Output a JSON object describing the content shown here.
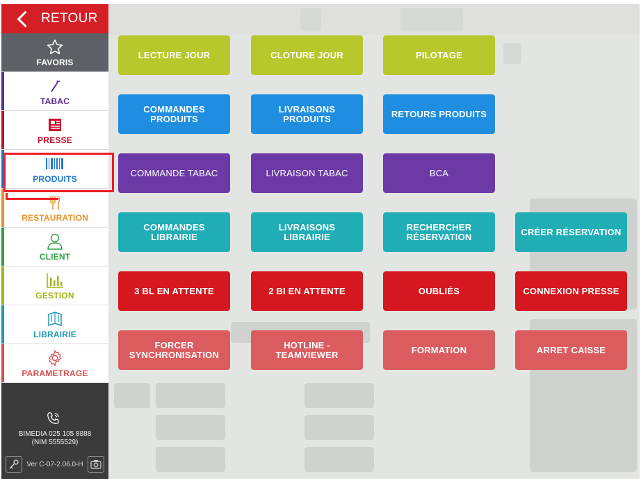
{
  "sidebar": {
    "back_label": "RETOUR",
    "items": [
      {
        "label": "FAVORIS",
        "icon": "star-icon",
        "color": "#ffffff",
        "bar": "#5d6167"
      },
      {
        "label": "TABAC",
        "icon": "cigarette-icon",
        "color": "#5b2d8e",
        "bar": "#5b2d8e"
      },
      {
        "label": "PRESSE",
        "icon": "newspaper-icon",
        "color": "#c8102e",
        "bar": "#c8102e"
      },
      {
        "label": "PRODUITS",
        "icon": "barcode-icon",
        "color": "#1f77d0",
        "bar": "#1f77d0"
      },
      {
        "label": "RESTAURATION",
        "icon": "food-icon",
        "color": "#e8932a",
        "bar": "#e8932a"
      },
      {
        "label": "CLIENT",
        "icon": "user-icon",
        "color": "#2f9e44",
        "bar": "#2f9e44"
      },
      {
        "label": "GESTION",
        "icon": "bar-chart-icon",
        "color": "#a3b515",
        "bar": "#a3b515"
      },
      {
        "label": "LIBRAIRIE",
        "icon": "book-icon",
        "color": "#1a9bb5",
        "bar": "#1a9bb5"
      },
      {
        "label": "PARAMETRAGE",
        "icon": "gear-icon",
        "color": "#d94f4f",
        "bar": "#d94f4f"
      }
    ],
    "footer": {
      "contact_line1": "BIMEDIA 025 105 8888",
      "contact_line2": "(NIM 5555529)",
      "version": "Ver C-07-2.06.0-H"
    }
  },
  "tiles": {
    "lecture_jour": "LECTURE JOUR",
    "cloture_jour": "CLOTURE JOUR",
    "pilotage": "PILOTAGE",
    "commandes_produits": "COMMANDES PRODUITS",
    "livraisons_produits": "LIVRAISONS PRODUITS",
    "retours_produits": "RETOURS PRODUITS",
    "commande_tabac": "COMMANDE TABAC",
    "livraison_tabac": "LIVRAISON TABAC",
    "bca": "BCA",
    "commandes_librairie": "COMMANDES LIBRAIRIE",
    "livraisons_librairie": "LIVRAISONS LIBRAIRIE",
    "rechercher_reservation": "RECHERCHER RÉSERVATION",
    "creer_reservation": "CRÉER RÉSERVATION",
    "bl_en_attente": "3 BL EN ATTENTE",
    "bi_en_attente": "2 BI EN ATTENTE",
    "oublies": "OUBLIÉS",
    "connexion_presse": "CONNEXION PRESSE",
    "forcer_synchronisation": "FORCER SYNCHRONISATION",
    "hotline_teamviewer": "HOTLINE - TEAMVIEWER",
    "formation": "FORMATION",
    "arret_caisse": "ARRET CAISSE"
  },
  "colors": {
    "lime": "#b6c82b",
    "blue": "#1f8ee0",
    "purple": "#6b3aa6",
    "teal": "#21adb6",
    "red": "#d5181f",
    "salmon": "#db5c5f",
    "highlight": "#ee1c24"
  }
}
